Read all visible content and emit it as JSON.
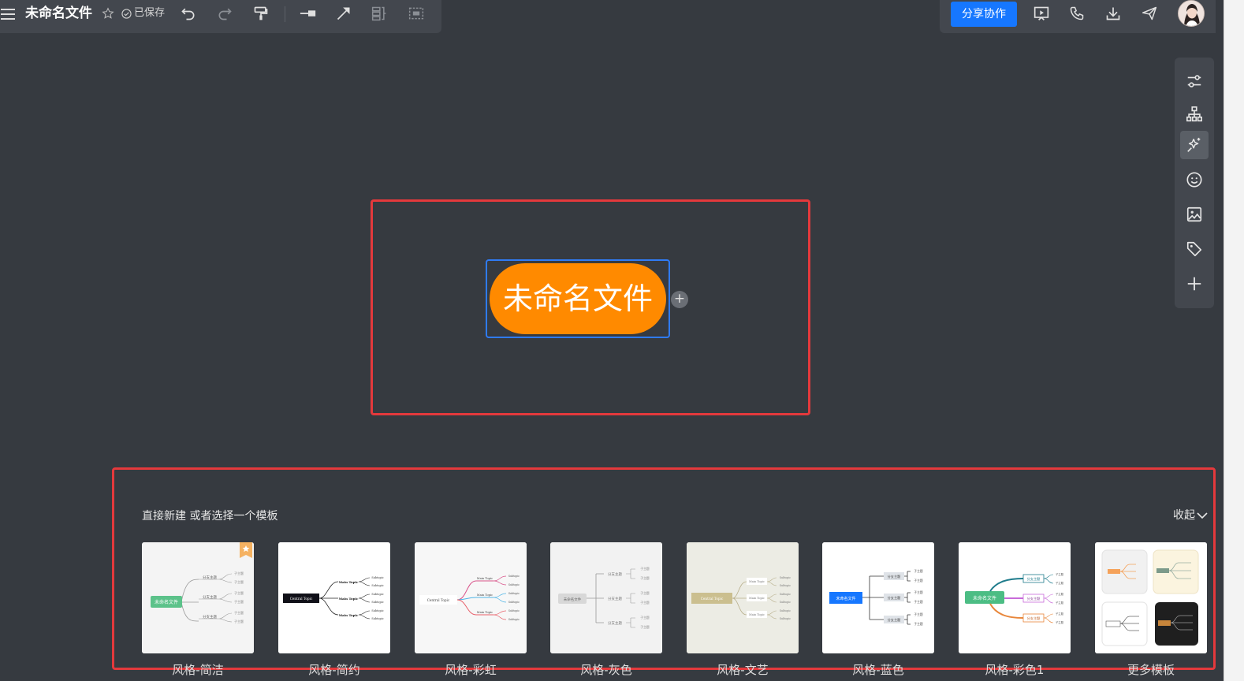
{
  "toolbar": {
    "doc_title": "未命名文件",
    "saved_status": "已保存",
    "icons": [
      "menu-icon",
      "star-icon",
      "check-circle-icon",
      "undo-icon",
      "redo-icon",
      "format-painter-icon",
      "line-style-icon",
      "arrow-connector-icon",
      "summary-icon",
      "boundary-icon"
    ]
  },
  "header_right": {
    "share_label": "分享协作",
    "icons": [
      "presentation-icon",
      "phone-icon",
      "download-icon",
      "send-icon",
      "avatar"
    ]
  },
  "sidebar": {
    "items": [
      "settings-sliders-icon",
      "structure-icon",
      "magic-style-icon",
      "emoji-icon",
      "image-icon",
      "tag-icon",
      "plus-icon"
    ],
    "active_index": 2
  },
  "canvas": {
    "root_topic": "未命名文件",
    "add_child_symbol": "+"
  },
  "template_panel": {
    "prompt": "直接新建 或者选择一个模板",
    "collapse_label": "收起",
    "templates": [
      {
        "label": "风格-简洁",
        "root_text": "未命名文件",
        "branch_text": "分支主题",
        "leaf_text": "子主题"
      },
      {
        "label": "风格-简约",
        "root_text": "Central Topic",
        "branch_text": "Main Topic",
        "leaf_text": "Subtopic"
      },
      {
        "label": "风格-彩虹",
        "root_text": "Central Topic",
        "branch_text": "Main Topic",
        "leaf_text": "Subtopic"
      },
      {
        "label": "风格-灰色",
        "root_text": "未命名文件",
        "branch_text": "分支主题",
        "leaf_text": "子主题"
      },
      {
        "label": "风格-文艺",
        "root_text": "Central Topic",
        "branch_text": "Main Topic",
        "leaf_text": "Subtopic"
      },
      {
        "label": "风格-蓝色",
        "root_text": "未命名文件",
        "branch_text": "分支主题",
        "leaf_text": "子主题"
      },
      {
        "label": "风格-彩色1",
        "root_text": "未命名文件",
        "branch_text": "分支主题",
        "leaf_text": "子主题"
      },
      {
        "label": "更多模板"
      }
    ]
  },
  "colors": {
    "canvas_bg": "#363a40",
    "toolbar_bg": "#43474e",
    "accent_blue": "#1677ff",
    "root_orange": "#ff8a00",
    "highlight_red": "#e4393c"
  }
}
